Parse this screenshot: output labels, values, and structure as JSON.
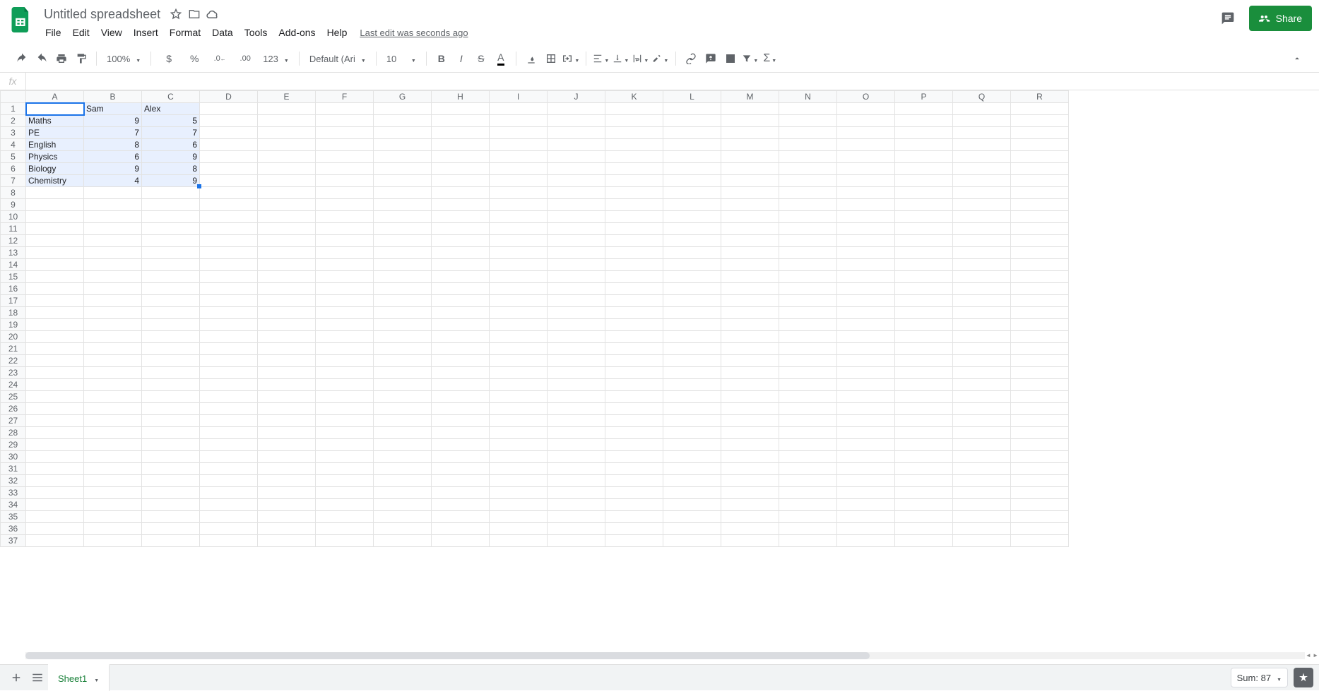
{
  "header": {
    "doc_title": "Untitled spreadsheet",
    "menus": [
      "File",
      "Edit",
      "View",
      "Insert",
      "Format",
      "Data",
      "Tools",
      "Add-ons",
      "Help"
    ],
    "edit_info": "Last edit was seconds ago",
    "share_label": "Share"
  },
  "toolbar": {
    "zoom": "100%",
    "number_format": "123",
    "font": "Default (Ari...",
    "font_size": "10"
  },
  "formula_bar": {
    "fx_label": "fx",
    "value": ""
  },
  "columns": [
    "A",
    "B",
    "C",
    "D",
    "E",
    "F",
    "G",
    "H",
    "I",
    "J",
    "K",
    "L",
    "M",
    "N",
    "O",
    "P",
    "Q",
    "R"
  ],
  "row_count": 37,
  "cells": {
    "1": {
      "A": "",
      "B": "Sam",
      "C": "Alex"
    },
    "2": {
      "A": "Maths",
      "B": "9",
      "C": "5"
    },
    "3": {
      "A": "PE",
      "B": "7",
      "C": "7"
    },
    "4": {
      "A": "English",
      "B": "8",
      "C": "6"
    },
    "5": {
      "A": "Physics",
      "B": "6",
      "C": "9"
    },
    "6": {
      "A": "Biology",
      "B": "9",
      "C": "8"
    },
    "7": {
      "A": "Chemistry",
      "B": "4",
      "C": "9"
    }
  },
  "selection": {
    "active": "A1",
    "range_rows": [
      1,
      7
    ],
    "range_cols": [
      "A",
      "C"
    ]
  },
  "sheet_tab": "Sheet1",
  "status": {
    "sum_label": "Sum: 87"
  }
}
